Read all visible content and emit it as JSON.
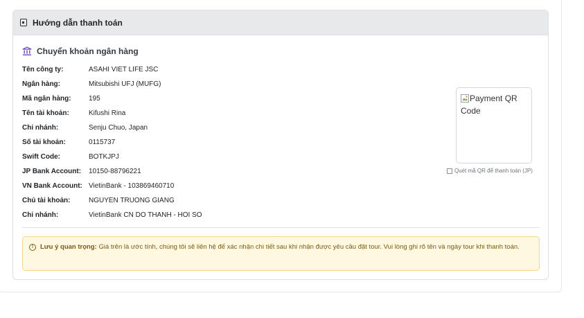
{
  "header": {
    "title": "Hướng dẫn thanh toán",
    "icon": "cash-icon"
  },
  "bank": {
    "section_title": "Chuyển khoản ngân hàng",
    "icon": "bank-icon",
    "rows": [
      {
        "label": "Tên công ty:",
        "value": "ASAHI VIET LIFE JSC"
      },
      {
        "label": "Ngân hàng:",
        "value": "Mitsubishi UFJ (MUFG)"
      },
      {
        "label": "Mã ngân hàng:",
        "value": "195"
      },
      {
        "label": "Tên tài khoản:",
        "value": "Kifushi Rina"
      },
      {
        "label": "Chi nhánh:",
        "value": "Senju Chuo, Japan"
      },
      {
        "label": "Số tài khoản:",
        "value": "0115737"
      },
      {
        "label": "Swift Code:",
        "value": "BOTKJPJ"
      },
      {
        "label": "JP Bank Account:",
        "value": "10150-88796221"
      },
      {
        "label": "VN Bank Account:",
        "value": "VietinBank - 103869460710"
      },
      {
        "label": "Chủ tài khoản:",
        "value": "NGUYEN TRUONG GIANG"
      },
      {
        "label": "Chi nhánh:",
        "value": "VietinBank CN DO THANH - HOI SO"
      }
    ]
  },
  "qr": {
    "alt": "Payment QR Code",
    "caption": "Quét mã QR để thanh toán (JP)"
  },
  "notice": {
    "label": "Lưu ý quan trọng:",
    "text": "Giá trên là ước tính, chúng tôi sẽ liên hệ để xác nhận chi tiết sau khi nhận được yêu cầu đặt tour. Vui lòng ghi rõ tên và ngày tour khi thanh toán."
  },
  "colors": {
    "alert_bg": "#fff8e1",
    "alert_border": "#f6d58b",
    "alert_text": "#7a5a16",
    "bank_icon": "#6f42c1",
    "header_bg": "#e8e9eb"
  }
}
